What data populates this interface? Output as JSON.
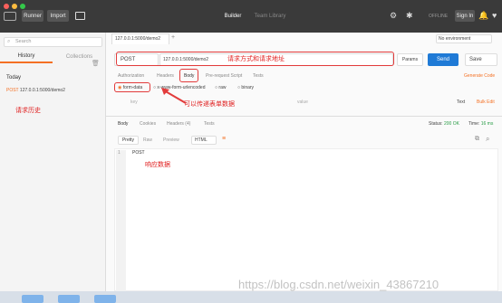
{
  "window": {
    "colors": {
      "close": "#fc605c",
      "min": "#fdbc40",
      "max": "#34c84a"
    }
  },
  "header": {
    "runner": "Runner",
    "import": "Import",
    "builder": "Builder",
    "team_library": "Team Library",
    "offline": "OFFLINE",
    "sign_in": "Sign In"
  },
  "sidebar": {
    "search_placeholder": "Search",
    "tabs": [
      "History",
      "Collections"
    ],
    "group": "Today",
    "items": [
      {
        "method": "POST",
        "url": "127.0.0.1:5000/demo2"
      }
    ]
  },
  "request": {
    "tab_label": "127.0.0.1:5000/demo2",
    "environment": "No environment",
    "method": "POST",
    "url": "127.0.0.1:5000/demo2",
    "params": "Params",
    "send": "Send",
    "save": "Save"
  },
  "req_tabs": [
    "Authorization",
    "Headers",
    "Body",
    "Pre-request Script",
    "Tests"
  ],
  "generate_code": "Generate Code",
  "body_types": [
    "form-data",
    "x-www-form-urlencoded",
    "raw",
    "binary"
  ],
  "kv": {
    "key": "key",
    "value": "value",
    "text": "Text",
    "bulk_edit": "Bulk Edit"
  },
  "response": {
    "tabs": [
      "Body",
      "Cookies",
      "Headers (4)",
      "Tests"
    ],
    "status_label": "Status:",
    "status": "200 OK",
    "time_label": "Time:",
    "time": "16 ms",
    "views": [
      "Pretty",
      "Raw",
      "Preview"
    ],
    "format": "HTML",
    "line_no": "1",
    "content": "POST"
  },
  "annotations": {
    "method_url": "请求方式和请求地址",
    "history": "请求历史",
    "form_data": "可以传递表单数据",
    "response": "响应数据"
  },
  "watermark": "https://blog.csdn.net/weixin_43867210"
}
